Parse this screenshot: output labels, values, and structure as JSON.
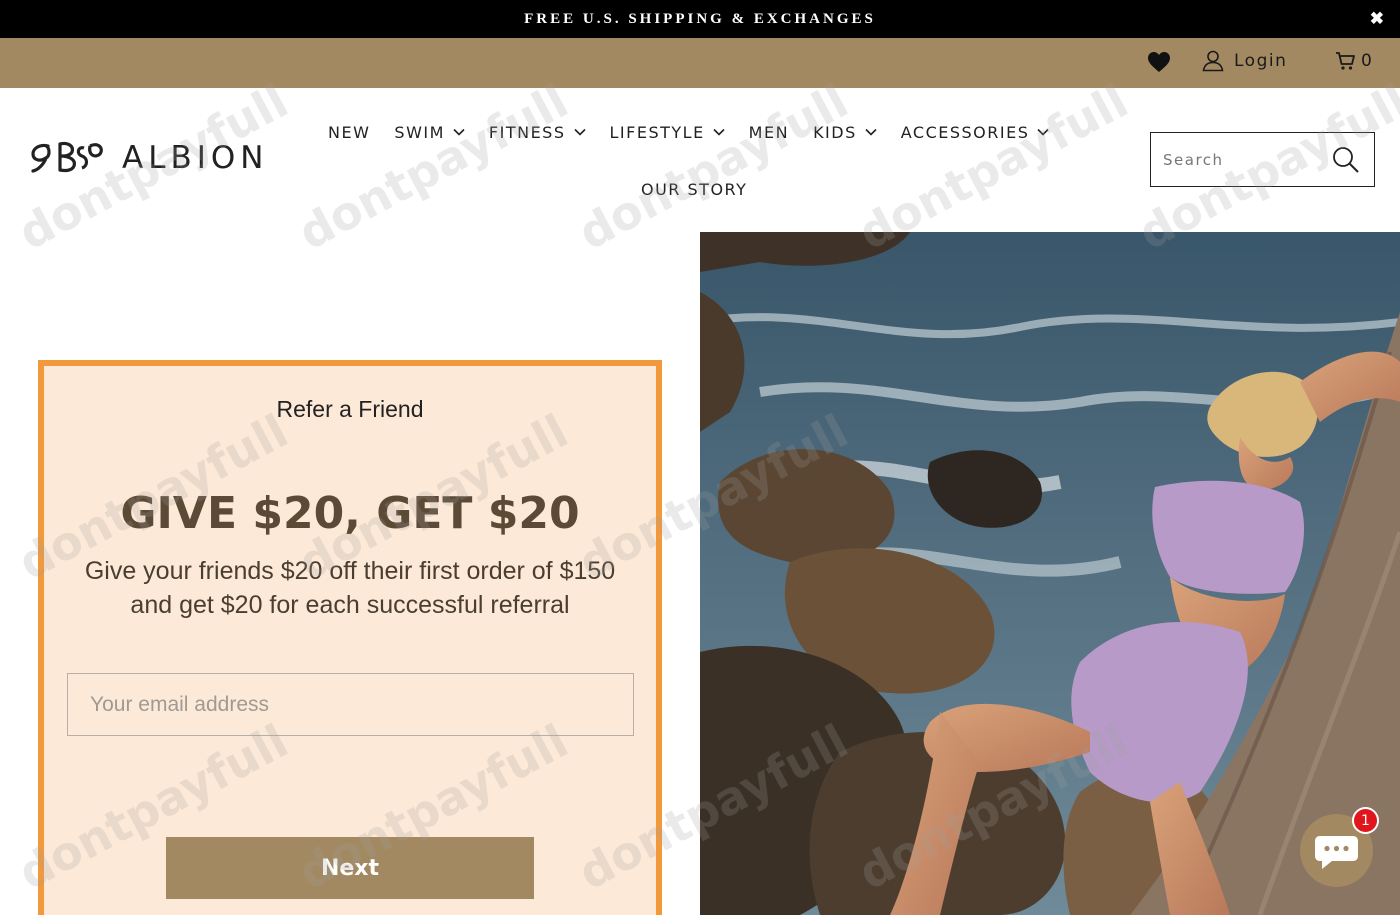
{
  "announcement": {
    "text": "FREE U.S. SHIPPING & EXCHANGES",
    "close_glyph": "✖"
  },
  "utility": {
    "wishlist_icon": "heart-icon",
    "login_label": "Login",
    "cart_count": "0"
  },
  "brand": {
    "name": "ALBION"
  },
  "nav": {
    "items": [
      {
        "label": "NEW",
        "dropdown": false
      },
      {
        "label": "SWIM",
        "dropdown": true
      },
      {
        "label": "FITNESS",
        "dropdown": true
      },
      {
        "label": "LIFESTYLE",
        "dropdown": true
      },
      {
        "label": "MEN",
        "dropdown": false
      },
      {
        "label": "KIDS",
        "dropdown": true
      },
      {
        "label": "ACCESSORIES",
        "dropdown": true
      }
    ],
    "our_story": "OUR STORY"
  },
  "search": {
    "placeholder": "Search"
  },
  "referral": {
    "title": "Refer a Friend",
    "headline": "GIVE $20, GET $20",
    "body": "Give your friends $20 off their first order of $150 and get $20 for each successful referral",
    "email_placeholder": "Your email address",
    "next_label": "Next"
  },
  "watermark": "dontpayfull",
  "chat": {
    "badge_count": "1"
  },
  "colors": {
    "accent": "#a28962",
    "panel_border": "#f29a3b",
    "panel_bg": "#fde9d8",
    "headline": "#5b4a36",
    "badge": "#e0161c"
  }
}
